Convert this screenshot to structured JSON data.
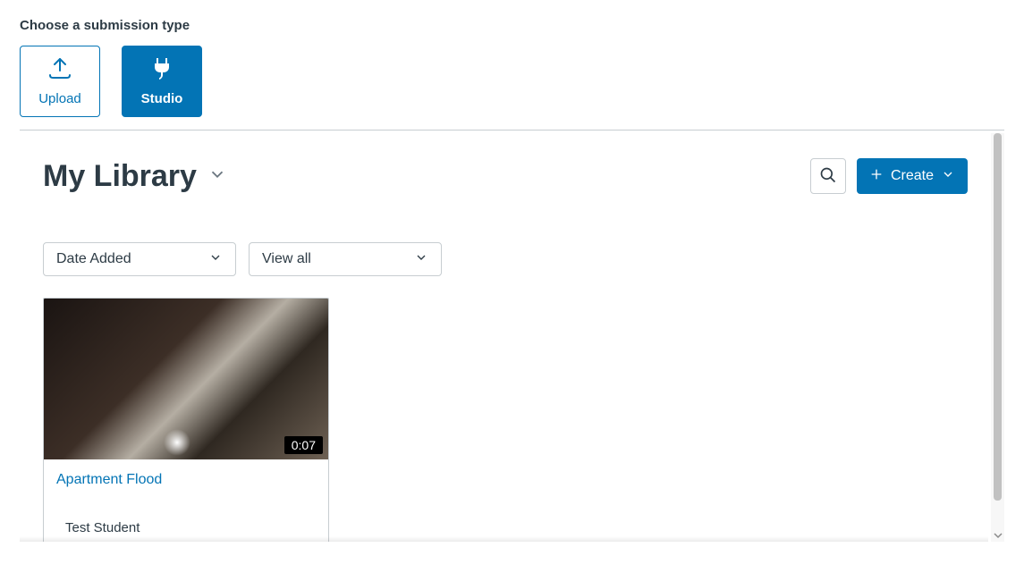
{
  "header": {
    "heading": "Choose a submission type",
    "tabs": {
      "upload_label": "Upload",
      "studio_label": "Studio"
    }
  },
  "library": {
    "title": "My Library",
    "create_label": "Create",
    "filters": {
      "sort_selected": "Date Added",
      "view_selected": "View all"
    },
    "items": [
      {
        "title": "Apartment Flood",
        "duration": "0:07",
        "author": "Test Student"
      }
    ]
  },
  "colors": {
    "accent": "#0374B5",
    "text": "#2d3b45",
    "border": "#c7cdd1"
  }
}
